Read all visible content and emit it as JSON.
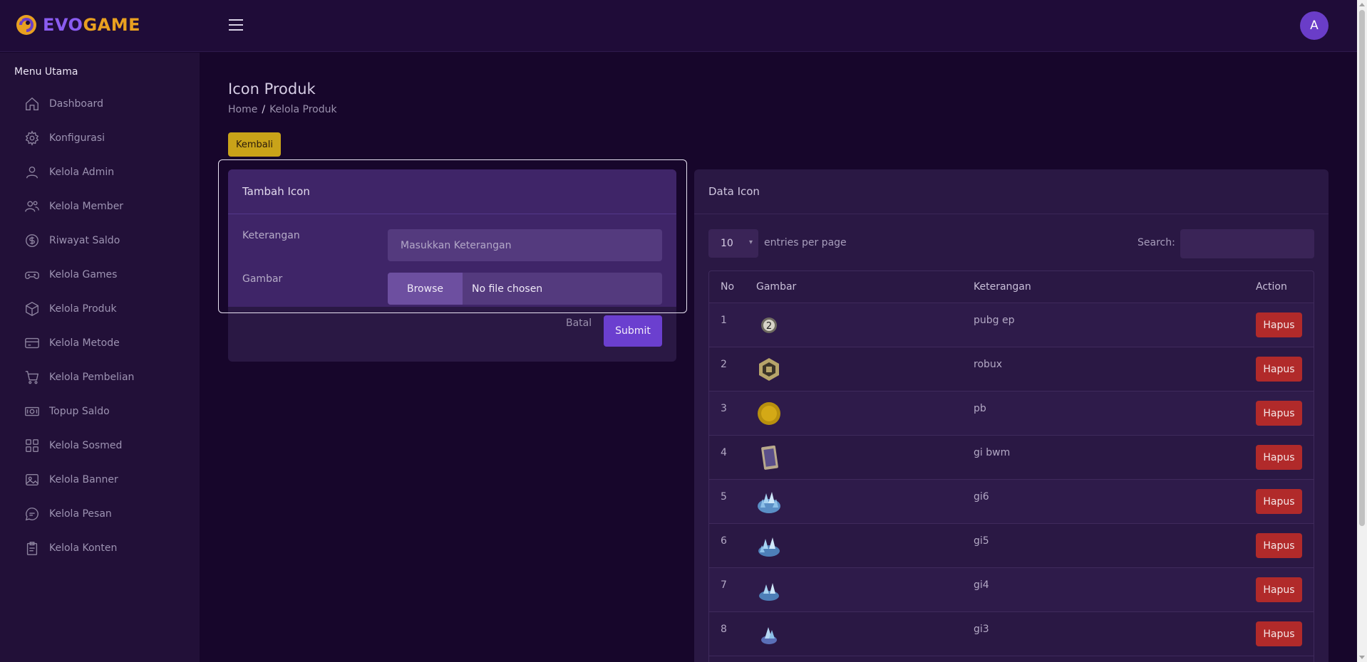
{
  "app": {
    "logo_prefix": "EVO",
    "logo_suffix": "GAME",
    "avatar_initial": "A"
  },
  "sidebar": {
    "title": "Menu Utama",
    "items": [
      {
        "label": "Dashboard",
        "icon": "home-icon"
      },
      {
        "label": "Konfigurasi",
        "icon": "gear-icon"
      },
      {
        "label": "Kelola Admin",
        "icon": "user-icon"
      },
      {
        "label": "Kelola Member",
        "icon": "users-icon"
      },
      {
        "label": "Riwayat Saldo",
        "icon": "dollar-circle-icon"
      },
      {
        "label": "Kelola Games",
        "icon": "gamepad-icon"
      },
      {
        "label": "Kelola Produk",
        "icon": "box-icon"
      },
      {
        "label": "Kelola Metode",
        "icon": "credit-card-icon"
      },
      {
        "label": "Kelola Pembelian",
        "icon": "cart-icon"
      },
      {
        "label": "Topup Saldo",
        "icon": "money-icon"
      },
      {
        "label": "Kelola Sosmed",
        "icon": "grid-icon"
      },
      {
        "label": "Kelola Banner",
        "icon": "image-icon"
      },
      {
        "label": "Kelola Pesan",
        "icon": "chat-icon"
      },
      {
        "label": "Kelola Konten",
        "icon": "document-icon"
      }
    ]
  },
  "page": {
    "title": "Icon Produk",
    "breadcrumb": [
      "Home",
      "Kelola Produk"
    ],
    "back_label": "Kembali"
  },
  "form": {
    "title": "Tambah Icon",
    "keterangan_label": "Keterangan",
    "keterangan_placeholder": "Masukkan Keterangan",
    "keterangan_value": "",
    "gambar_label": "Gambar",
    "browse_label": "Browse",
    "file_status": "No file chosen",
    "cancel_label": "Batal",
    "submit_label": "Submit"
  },
  "table": {
    "title": "Data Icon",
    "entries_value": "10",
    "entries_label": "entries per page",
    "search_label": "Search:",
    "columns": [
      "No",
      "Gambar",
      "Keterangan",
      "Action"
    ],
    "action_label": "Hapus",
    "rows": [
      {
        "no": "1",
        "keterangan": "pubg ep",
        "icon": "pubg-icon"
      },
      {
        "no": "2",
        "keterangan": "robux",
        "icon": "robux-icon"
      },
      {
        "no": "3",
        "keterangan": "pb",
        "icon": "coin-icon"
      },
      {
        "no": "4",
        "keterangan": "gi bwm",
        "icon": "card-icon"
      },
      {
        "no": "5",
        "keterangan": "gi6",
        "icon": "crystal-pile-icon"
      },
      {
        "no": "6",
        "keterangan": "gi5",
        "icon": "crystal-pile-icon"
      },
      {
        "no": "7",
        "keterangan": "gi4",
        "icon": "crystal-pile-icon"
      },
      {
        "no": "8",
        "keterangan": "gi3",
        "icon": "crystal-icon"
      }
    ]
  },
  "colors": {
    "accent": "#6b3fcf",
    "warning": "#c9a319",
    "danger": "#b12a2a",
    "brand_orange": "#e8a020"
  }
}
